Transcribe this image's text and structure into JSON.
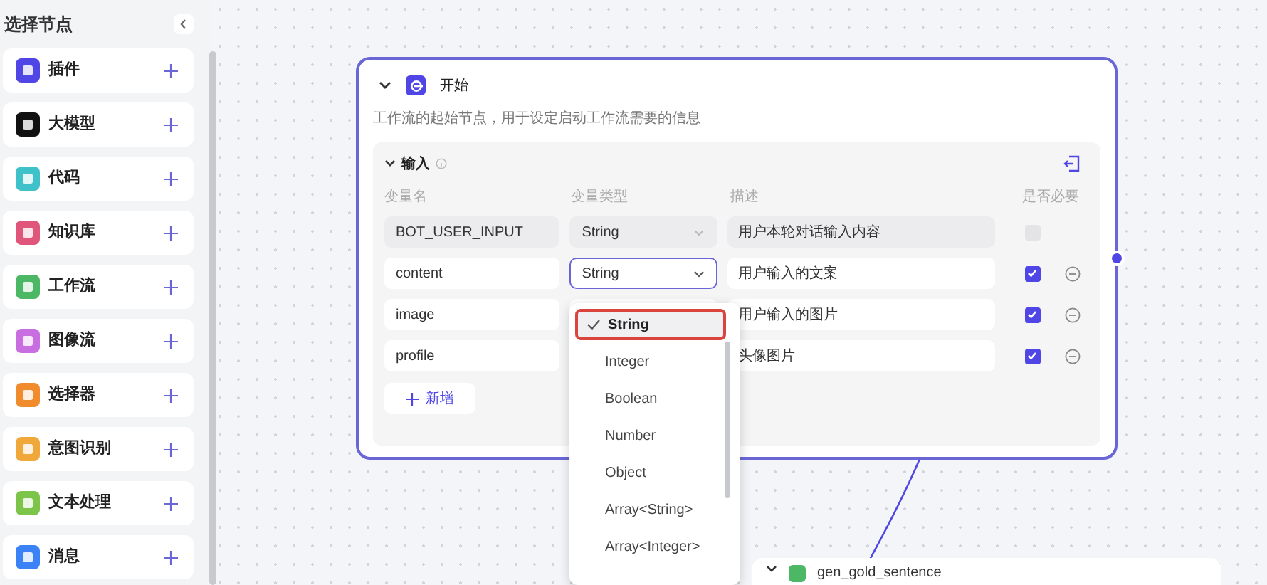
{
  "sidebar": {
    "title": "选择节点",
    "items": [
      {
        "label": "插件",
        "color": "#4f46e5"
      },
      {
        "label": "大模型",
        "color": "#111111"
      },
      {
        "label": "代码",
        "color": "#3fc1c9"
      },
      {
        "label": "知识库",
        "color": "#e0557a"
      },
      {
        "label": "工作流",
        "color": "#4cb865"
      },
      {
        "label": "图像流",
        "color": "#c86ee0"
      },
      {
        "label": "选择器",
        "color": "#f08c2e"
      },
      {
        "label": "意图识别",
        "color": "#f0a83a"
      },
      {
        "label": "文本处理",
        "color": "#7cc44a"
      },
      {
        "label": "消息",
        "color": "#3b82f6"
      }
    ]
  },
  "node": {
    "title": "开始",
    "description": "工作流的起始节点，用于设定启动工作流需要的信息",
    "section": {
      "title": "输入",
      "expanded": true,
      "columns": [
        "变量名",
        "变量类型",
        "描述",
        "是否必要"
      ],
      "rows": [
        {
          "name": "BOT_USER_INPUT",
          "type": "String",
          "description": "用户本轮对话输入内容",
          "required": false,
          "disabled": true,
          "focused": false
        },
        {
          "name": "content",
          "type": "String",
          "description": "用户输入的文案",
          "required": true,
          "disabled": false,
          "focused": true
        },
        {
          "name": "image",
          "description": "用户输入的图片",
          "required": true,
          "disabled": false,
          "focused": false
        },
        {
          "name": "profile",
          "description": "头像图片",
          "required": true,
          "disabled": false,
          "focused": false
        }
      ],
      "add_button": "新增"
    }
  },
  "dropdown": {
    "options": [
      {
        "label": "String",
        "selected": true
      },
      {
        "label": "Integer",
        "selected": false
      },
      {
        "label": "Boolean",
        "selected": false
      },
      {
        "label": "Number",
        "selected": false
      },
      {
        "label": "Object",
        "selected": false
      },
      {
        "label": "Array<String>",
        "selected": false
      },
      {
        "label": "Array<Integer>",
        "selected": false
      }
    ]
  },
  "next_node": {
    "title": "gen_gold_sentence"
  }
}
